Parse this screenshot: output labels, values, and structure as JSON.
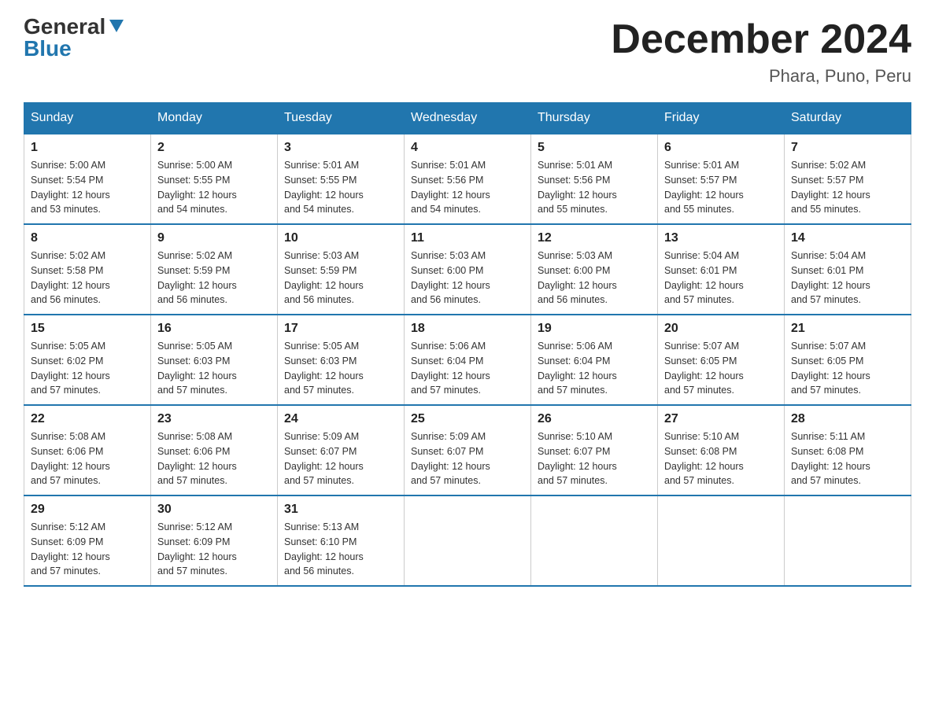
{
  "logo": {
    "general": "General",
    "blue": "Blue"
  },
  "title": "December 2024",
  "subtitle": "Phara, Puno, Peru",
  "days_of_week": [
    "Sunday",
    "Monday",
    "Tuesday",
    "Wednesday",
    "Thursday",
    "Friday",
    "Saturday"
  ],
  "weeks": [
    [
      {
        "day": "1",
        "sunrise": "5:00 AM",
        "sunset": "5:54 PM",
        "daylight": "12 hours and 53 minutes."
      },
      {
        "day": "2",
        "sunrise": "5:00 AM",
        "sunset": "5:55 PM",
        "daylight": "12 hours and 54 minutes."
      },
      {
        "day": "3",
        "sunrise": "5:01 AM",
        "sunset": "5:55 PM",
        "daylight": "12 hours and 54 minutes."
      },
      {
        "day": "4",
        "sunrise": "5:01 AM",
        "sunset": "5:56 PM",
        "daylight": "12 hours and 54 minutes."
      },
      {
        "day": "5",
        "sunrise": "5:01 AM",
        "sunset": "5:56 PM",
        "daylight": "12 hours and 55 minutes."
      },
      {
        "day": "6",
        "sunrise": "5:01 AM",
        "sunset": "5:57 PM",
        "daylight": "12 hours and 55 minutes."
      },
      {
        "day": "7",
        "sunrise": "5:02 AM",
        "sunset": "5:57 PM",
        "daylight": "12 hours and 55 minutes."
      }
    ],
    [
      {
        "day": "8",
        "sunrise": "5:02 AM",
        "sunset": "5:58 PM",
        "daylight": "12 hours and 56 minutes."
      },
      {
        "day": "9",
        "sunrise": "5:02 AM",
        "sunset": "5:59 PM",
        "daylight": "12 hours and 56 minutes."
      },
      {
        "day": "10",
        "sunrise": "5:03 AM",
        "sunset": "5:59 PM",
        "daylight": "12 hours and 56 minutes."
      },
      {
        "day": "11",
        "sunrise": "5:03 AM",
        "sunset": "6:00 PM",
        "daylight": "12 hours and 56 minutes."
      },
      {
        "day": "12",
        "sunrise": "5:03 AM",
        "sunset": "6:00 PM",
        "daylight": "12 hours and 56 minutes."
      },
      {
        "day": "13",
        "sunrise": "5:04 AM",
        "sunset": "6:01 PM",
        "daylight": "12 hours and 57 minutes."
      },
      {
        "day": "14",
        "sunrise": "5:04 AM",
        "sunset": "6:01 PM",
        "daylight": "12 hours and 57 minutes."
      }
    ],
    [
      {
        "day": "15",
        "sunrise": "5:05 AM",
        "sunset": "6:02 PM",
        "daylight": "12 hours and 57 minutes."
      },
      {
        "day": "16",
        "sunrise": "5:05 AM",
        "sunset": "6:03 PM",
        "daylight": "12 hours and 57 minutes."
      },
      {
        "day": "17",
        "sunrise": "5:05 AM",
        "sunset": "6:03 PM",
        "daylight": "12 hours and 57 minutes."
      },
      {
        "day": "18",
        "sunrise": "5:06 AM",
        "sunset": "6:04 PM",
        "daylight": "12 hours and 57 minutes."
      },
      {
        "day": "19",
        "sunrise": "5:06 AM",
        "sunset": "6:04 PM",
        "daylight": "12 hours and 57 minutes."
      },
      {
        "day": "20",
        "sunrise": "5:07 AM",
        "sunset": "6:05 PM",
        "daylight": "12 hours and 57 minutes."
      },
      {
        "day": "21",
        "sunrise": "5:07 AM",
        "sunset": "6:05 PM",
        "daylight": "12 hours and 57 minutes."
      }
    ],
    [
      {
        "day": "22",
        "sunrise": "5:08 AM",
        "sunset": "6:06 PM",
        "daylight": "12 hours and 57 minutes."
      },
      {
        "day": "23",
        "sunrise": "5:08 AM",
        "sunset": "6:06 PM",
        "daylight": "12 hours and 57 minutes."
      },
      {
        "day": "24",
        "sunrise": "5:09 AM",
        "sunset": "6:07 PM",
        "daylight": "12 hours and 57 minutes."
      },
      {
        "day": "25",
        "sunrise": "5:09 AM",
        "sunset": "6:07 PM",
        "daylight": "12 hours and 57 minutes."
      },
      {
        "day": "26",
        "sunrise": "5:10 AM",
        "sunset": "6:07 PM",
        "daylight": "12 hours and 57 minutes."
      },
      {
        "day": "27",
        "sunrise": "5:10 AM",
        "sunset": "6:08 PM",
        "daylight": "12 hours and 57 minutes."
      },
      {
        "day": "28",
        "sunrise": "5:11 AM",
        "sunset": "6:08 PM",
        "daylight": "12 hours and 57 minutes."
      }
    ],
    [
      {
        "day": "29",
        "sunrise": "5:12 AM",
        "sunset": "6:09 PM",
        "daylight": "12 hours and 57 minutes."
      },
      {
        "day": "30",
        "sunrise": "5:12 AM",
        "sunset": "6:09 PM",
        "daylight": "12 hours and 57 minutes."
      },
      {
        "day": "31",
        "sunrise": "5:13 AM",
        "sunset": "6:10 PM",
        "daylight": "12 hours and 56 minutes."
      },
      null,
      null,
      null,
      null
    ]
  ],
  "labels": {
    "sunrise": "Sunrise:",
    "sunset": "Sunset:",
    "daylight": "Daylight:"
  }
}
